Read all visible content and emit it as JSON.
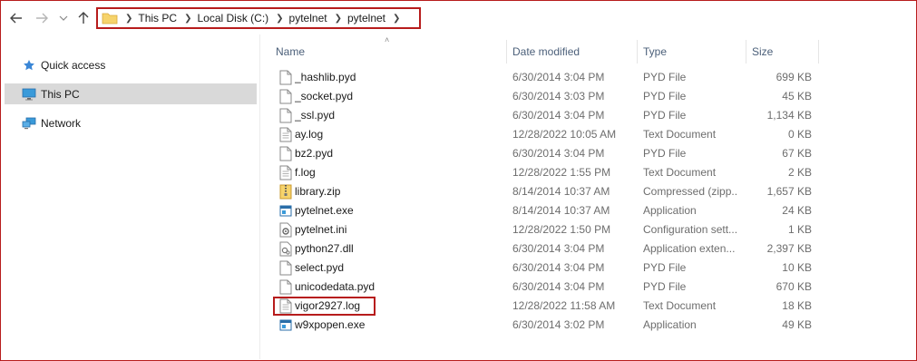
{
  "address_bar": {
    "crumbs": [
      "This PC",
      "Local Disk (C:)",
      "pytelnet",
      "pytelnet"
    ]
  },
  "sidebar": {
    "items": [
      {
        "label": "Quick access",
        "icon": "star-icon",
        "selected": false
      },
      {
        "label": "This PC",
        "icon": "monitor-icon",
        "selected": true
      },
      {
        "label": "Network",
        "icon": "network-icon",
        "selected": false
      }
    ]
  },
  "columns": {
    "name": "Name",
    "date": "Date modified",
    "type": "Type",
    "size": "Size"
  },
  "files": [
    {
      "name": "_hashlib.pyd",
      "date": "6/30/2014 3:04 PM",
      "type": "PYD File",
      "size": "699 KB",
      "icon": "blank-file-icon"
    },
    {
      "name": "_socket.pyd",
      "date": "6/30/2014 3:03 PM",
      "type": "PYD File",
      "size": "45 KB",
      "icon": "blank-file-icon"
    },
    {
      "name": "_ssl.pyd",
      "date": "6/30/2014 3:04 PM",
      "type": "PYD File",
      "size": "1,134 KB",
      "icon": "blank-file-icon"
    },
    {
      "name": "ay.log",
      "date": "12/28/2022 10:05 AM",
      "type": "Text Document",
      "size": "0 KB",
      "icon": "text-file-icon"
    },
    {
      "name": "bz2.pyd",
      "date": "6/30/2014 3:04 PM",
      "type": "PYD File",
      "size": "67 KB",
      "icon": "blank-file-icon"
    },
    {
      "name": "f.log",
      "date": "12/28/2022 1:55 PM",
      "type": "Text Document",
      "size": "2 KB",
      "icon": "text-file-icon"
    },
    {
      "name": "library.zip",
      "date": "8/14/2014 10:37 AM",
      "type": "Compressed (zipp...",
      "size": "1,657 KB",
      "icon": "zip-file-icon"
    },
    {
      "name": "pytelnet.exe",
      "date": "8/14/2014 10:37 AM",
      "type": "Application",
      "size": "24 KB",
      "icon": "application-icon"
    },
    {
      "name": "pytelnet.ini",
      "date": "12/28/2022 1:50 PM",
      "type": "Configuration sett...",
      "size": "1 KB",
      "icon": "config-file-icon"
    },
    {
      "name": "python27.dll",
      "date": "6/30/2014 3:04 PM",
      "type": "Application exten...",
      "size": "2,397 KB",
      "icon": "dll-file-icon"
    },
    {
      "name": "select.pyd",
      "date": "6/30/2014 3:04 PM",
      "type": "PYD File",
      "size": "10 KB",
      "icon": "blank-file-icon"
    },
    {
      "name": "unicodedata.pyd",
      "date": "6/30/2014 3:04 PM",
      "type": "PYD File",
      "size": "670 KB",
      "icon": "blank-file-icon"
    },
    {
      "name": "vigor2927.log",
      "date": "12/28/2022 11:58 AM",
      "type": "Text Document",
      "size": "18 KB",
      "icon": "text-file-icon"
    },
    {
      "name": "w9xpopen.exe",
      "date": "6/30/2014 3:02 PM",
      "type": "Application",
      "size": "49 KB",
      "icon": "application-icon"
    }
  ],
  "colors": {
    "highlight_border": "#b71c1c",
    "selected_bg": "#d9d9d9",
    "header_text": "#4c607a",
    "folder_yellow": "#f6d36b"
  }
}
